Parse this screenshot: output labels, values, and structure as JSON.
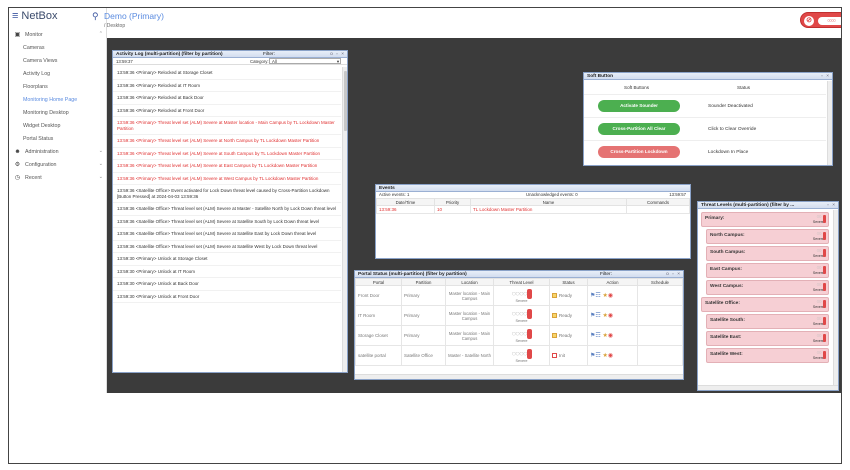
{
  "app": {
    "name": "NetBox",
    "tenant": "Demo (Primary)",
    "breadcrumb": "/ Desktop",
    "user_initials": "SA"
  },
  "sidebar": {
    "monitor": "Monitor",
    "items": [
      "Cameras",
      "Camera Views",
      "Activity Log",
      "Floorplans",
      "Monitoring Home Page",
      "Monitoring Desktop",
      "Widget Desktop",
      "Portal Status"
    ],
    "active_index": 4,
    "administration": "Administration",
    "configuration": "Configuration",
    "recent": "Recent"
  },
  "activity_log": {
    "title": "Activity Log (multi-partition) (filter by partition)",
    "filter_label": "Filter:",
    "time": "13:59:37",
    "category_label": "Category:",
    "category_value": "All",
    "rows": [
      {
        "text": "13:59:36 <Primary> Relocked at Storage Closet",
        "red": false
      },
      {
        "text": "13:59:36 <Primary> Relocked at IT Room",
        "red": false
      },
      {
        "text": "13:59:36 <Primary> Relocked at Back Door",
        "red": false
      },
      {
        "text": "13:59:36 <Primary> Relocked at Front Door",
        "red": false
      },
      {
        "text": "13:59:36 <Primary> Threat level set (ALM) Severe at Master location - Main Campus by TL Lockdown Master Partition",
        "red": true
      },
      {
        "text": "13:59:36 <Primary> Threat level set (ALM) Severe at North Campus by TL Lockdown Master Partition",
        "red": true
      },
      {
        "text": "13:59:36 <Primary> Threat level set (ALM) Severe at South Campus by TL Lockdown Master Partition",
        "red": true
      },
      {
        "text": "13:59:36 <Primary> Threat level set (ALM) Severe at East Campus by TL Lockdown Master Partition",
        "red": true
      },
      {
        "text": "13:59:36 <Primary> Threat level set (ALM) Severe at West Campus by TL Lockdown Master Partition",
        "red": true
      },
      {
        "text": "13:59:36 <Satellite Office> Event activated for Lock Down threat level caused by Cross-Partition Lockdown [Button Pressed] at 2024-04-03 13:59:36",
        "red": false
      },
      {
        "text": "13:59:36 <Satellite Office> Threat level set (ALM) Severe at Master - Satellite North by Lock Down threat level",
        "red": false
      },
      {
        "text": "13:59:36 <Satellite Office> Threat level set (ALM) Severe at Satellite South by Lock Down threat level",
        "red": false
      },
      {
        "text": "13:59:36 <Satellite Office> Threat level set (ALM) Severe at Satellite East by Lock Down threat level",
        "red": false
      },
      {
        "text": "13:59:36 <Satellite Office> Threat level set (ALM) Severe at Satellite West by Lock Down threat level",
        "red": false
      },
      {
        "text": "13:59:30 <Primary> Unlock at Storage Closet",
        "red": false
      },
      {
        "text": "13:59:30 <Primary> Unlock at IT Room",
        "red": false
      },
      {
        "text": "13:59:30 <Primary> Unlock at Back Door",
        "red": false
      },
      {
        "text": "13:59:30 <Primary> Unlock at Front Door",
        "red": false
      }
    ]
  },
  "soft_button": {
    "title": "Soft Button",
    "col1": "Soft Buttons",
    "col2": "Status",
    "rows": [
      {
        "label": "Activate Sounder",
        "status": "Sounder Deactivated",
        "color": "#4caf50"
      },
      {
        "label": "Cross-Partition All Clear",
        "status": "Click to Clear Override",
        "color": "#4caf50"
      },
      {
        "label": "Cross-Partition Lockdown",
        "status": "Lockdown In Place",
        "color": "#e57373"
      }
    ]
  },
  "events": {
    "title": "Events",
    "active": "Active events: 1",
    "unack": "Unacknowledged events: 0",
    "time": "13:59:57",
    "cols": [
      "Date/Time",
      "Priority",
      "Name",
      "Commands"
    ],
    "row": {
      "time": "13:59:36",
      "priority": "10",
      "name": "TL Lockdown Master Partition"
    }
  },
  "portal_status": {
    "title": "Portal Status (multi-partition) (filter by partition)",
    "filter_label": "Filter:",
    "cols": [
      "Portal",
      "Partition",
      "Location",
      "Threat Level",
      "Status",
      "Action",
      "Schedule"
    ],
    "level_label": "Severe",
    "rows": [
      {
        "portal": "Front Door",
        "partition": "Primary",
        "location": "Master location - Main Campus",
        "status": "Ready"
      },
      {
        "portal": "IT Room",
        "partition": "Primary",
        "location": "Master location - Main Campus",
        "status": "Ready"
      },
      {
        "portal": "Storage Closet",
        "partition": "Primary",
        "location": "Master location - Main Campus",
        "status": "Ready"
      },
      {
        "portal": "satellite portal",
        "partition": "Satellite Office",
        "location": "Master - Satellite North",
        "status": "Init"
      }
    ]
  },
  "threat_levels": {
    "title": "Threat Levels (multi-partition) (filter by ...",
    "level_label": "Severe",
    "groups": [
      {
        "name": "Primary:",
        "indent": false
      },
      {
        "name": "North Campus:",
        "indent": true
      },
      {
        "name": "South Campus:",
        "indent": true
      },
      {
        "name": "East Campus:",
        "indent": true
      },
      {
        "name": "West Campus:",
        "indent": true
      },
      {
        "name": "Satellite Office:",
        "indent": false
      },
      {
        "name": "Satellite South:",
        "indent": true
      },
      {
        "name": "Satellite East:",
        "indent": true
      },
      {
        "name": "Satellite West:",
        "indent": true
      }
    ]
  },
  "colors": {
    "accent": "#5a8be0",
    "alarm": "#e04848",
    "desktop": "#3b3b3b"
  }
}
